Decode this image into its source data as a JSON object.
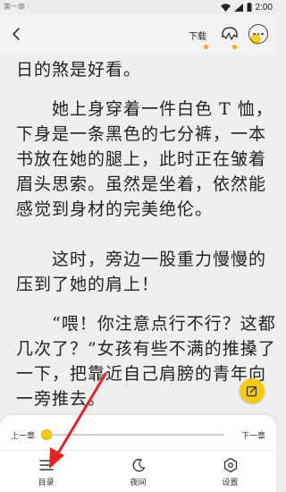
{
  "status_bar": {
    "left_text": "第一章 ·",
    "time": "2:00"
  },
  "toolbar": {
    "download_label": "下载",
    "icons": [
      "back-icon",
      "headphone-icon",
      "more-icon"
    ]
  },
  "reader": {
    "paragraphs": [
      {
        "lines": [
          "日的煞是好看。"
        ]
      },
      {
        "lines": [
          "　　她上身穿着一件白色 T 恤，",
          "下身是一条黑色的七分裤，一本",
          "书放在她的腿上，此时正在皱着",
          "眉头思索。虽然是坐着，依然能",
          "感觉到身材的完美绝伦。"
        ]
      },
      {
        "lines": [
          "　　这时，旁边一股重力慢慢的",
          "压到了她的肩上！"
        ]
      },
      {
        "lines": [
          "　　“喂！你注意点行不行？这都",
          "几次了？”女孩有些不满的推搡了",
          "一下，把靠近自己肩膀的青年向",
          "一旁推去。"
        ]
      }
    ]
  },
  "progress": {
    "prev_label": "上一章",
    "next_label": "下一章",
    "value": 0.0
  },
  "bottom_nav": {
    "items": [
      {
        "label": "目录",
        "icon": "menu-list-icon"
      },
      {
        "label": "夜间",
        "icon": "moon-icon"
      },
      {
        "label": "设置",
        "icon": "settings-icon"
      }
    ]
  },
  "colors": {
    "accent": "#f6c915",
    "annotation": "#e32424",
    "background": "#efefef"
  }
}
